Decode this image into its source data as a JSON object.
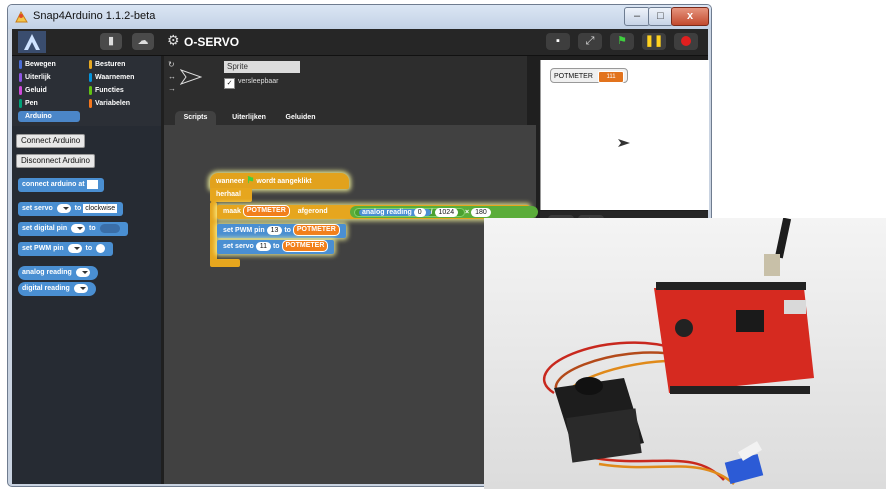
{
  "window": {
    "title": "Snap4Arduino 1.1.2-beta",
    "close_label": "x",
    "min_label": "–",
    "max_label": "□"
  },
  "toolbar": {
    "project_name": "O-SERVO",
    "gear_label": "⚙"
  },
  "categories": [
    {
      "label": "Bewegen",
      "color": "#4a6cd4"
    },
    {
      "label": "Besturen",
      "color": "#e6a822"
    },
    {
      "label": "Uiterlijk",
      "color": "#8f56e3"
    },
    {
      "label": "Waarnemen",
      "color": "#0494dc"
    },
    {
      "label": "Geluid",
      "color": "#cf4ad9"
    },
    {
      "label": "Functies",
      "color": "#62c213"
    },
    {
      "label": "Pen",
      "color": "#00a178"
    },
    {
      "label": "Variabelen",
      "color": "#f3761d"
    },
    {
      "label": "Arduino",
      "color": "#4b86c8"
    }
  ],
  "palette": {
    "connect_btn": "Connect Arduino",
    "disconnect_btn": "Disconnect Arduino",
    "blocks": {
      "connect": "connect arduino at",
      "set_servo": "set servo",
      "set_servo_to": "to",
      "clockwise": "clockwise",
      "set_digital": "set digital pin",
      "set_digital_to": "to",
      "set_pwm": "set PWM pin",
      "set_pwm_to": "to",
      "analog": "analog reading",
      "digital": "digital reading"
    }
  },
  "sprite": {
    "name": "Sprite",
    "draggable_label": "versleepbaar",
    "check": "✓"
  },
  "tabs": [
    "Scripts",
    "Uiterlijken",
    "Geluiden"
  ],
  "script": {
    "hat_when": "wanneer",
    "hat_clicked": "wordt aangeklikt",
    "forever": "herhaal",
    "set_var": "maak",
    "var_name": "POTMETER",
    "rounded": "afgerond",
    "analog": "analog reading",
    "analog_pin": "0",
    "divide": "/",
    "div_value": "1024",
    "times": "×",
    "mul_value": "180",
    "pwm_block": "set PWM pin",
    "pwm_pin": "13",
    "pwm_to": "to",
    "pwm_var": "POTMETER",
    "servo_block": "set servo",
    "servo_pin": "11",
    "servo_to": "to",
    "servo_var": "POTMETER"
  },
  "stage": {
    "watcher_label": "POTMETER",
    "watcher_value": "111"
  },
  "colors": {
    "arduino_block": "#4a8fd2",
    "control": "#e6a61e",
    "operators": "#5bad3a",
    "variables": "#f27f1b"
  }
}
